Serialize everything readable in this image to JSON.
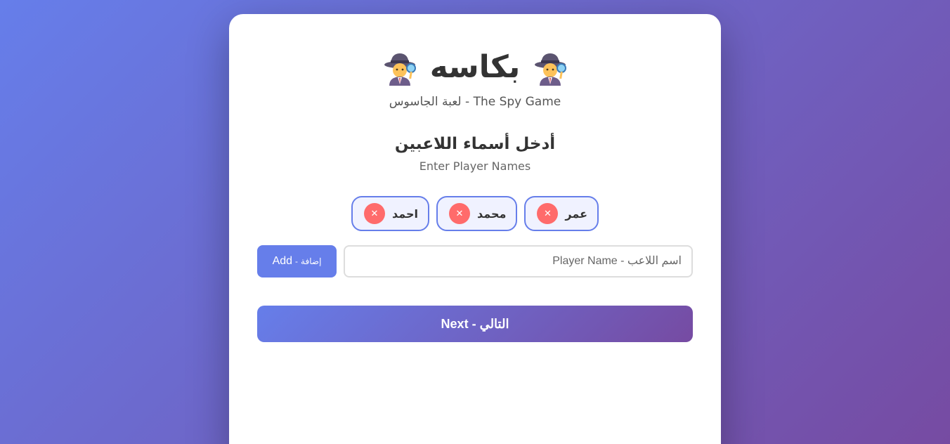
{
  "header": {
    "title": "بكاسه",
    "left_icon": "spy-emoji-icon",
    "right_icon": "spy-emoji-icon",
    "subtitle": "لعبة الجاسوس - The Spy Game"
  },
  "section": {
    "title": "أدخل أسماء اللاعبين",
    "subtitle": "Enter Player Names"
  },
  "players": [
    {
      "name": "عمر",
      "remove_label": "✕"
    },
    {
      "name": "محمد",
      "remove_label": "✕"
    },
    {
      "name": "احمد",
      "remove_label": "✕"
    }
  ],
  "add_form": {
    "placeholder": "اسم اللاعب - Player Name",
    "value": "",
    "button_label_en": "Add",
    "button_label_sep": "-",
    "button_label_ar": "إضافة"
  },
  "next_button": {
    "label": "Next - التالي"
  },
  "colors": {
    "accent": "#667eea",
    "accent_dark": "#764ba2",
    "remove": "#ff6b6b",
    "chip_bg": "#f0f2ff"
  }
}
